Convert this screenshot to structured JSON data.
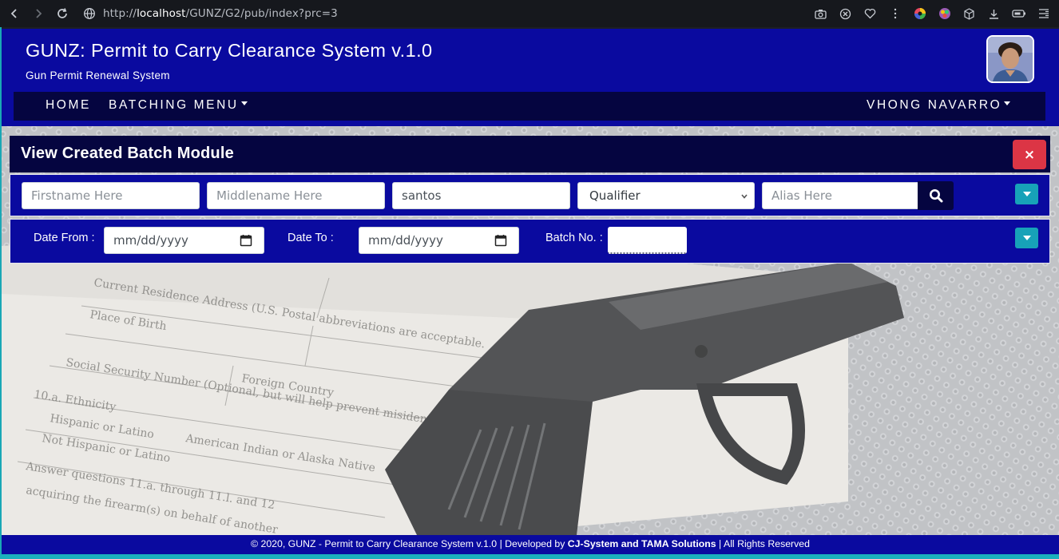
{
  "browser": {
    "url_prefix": "http://",
    "url_host": "localhost",
    "url_path": "/GUNZ/G2/pub/index?prc=3"
  },
  "header": {
    "title": "GUNZ: Permit to Carry Clearance System v.1.0",
    "subtitle": "Gun Permit Renewal System"
  },
  "nav": {
    "home": "HOME",
    "batching_menu": "BATCHING MENU",
    "user_menu": "VHONG NAVARRO"
  },
  "module": {
    "title": "View Created Batch Module",
    "close_label": "×"
  },
  "search": {
    "firstname_placeholder": "Firstname Here",
    "firstname_value": "",
    "middlename_placeholder": "Middlename Here",
    "middlename_value": "",
    "lastname_value": "santos",
    "qualifier_selected": "Qualifier",
    "alias_placeholder": "Alias Here",
    "alias_value": ""
  },
  "date_filter": {
    "date_from_label": "Date From :",
    "date_from_value": "mm/dd/yyyy",
    "date_to_label": "Date To :",
    "date_to_value": "mm/dd/yyyy",
    "batch_no_label": "Batch No. :",
    "batch_no_value": ""
  },
  "footer": {
    "prefix": "© 2020, GUNZ - Permit to Carry Clearance System v.1.0 | Developed by ",
    "developer": "CJ-System and TAMA Solutions",
    "suffix": " | All Rights Reserved"
  },
  "colors": {
    "header_blue": "#0a0a9f",
    "navy": "#050540",
    "danger": "#dc3545",
    "info": "#17a2b8"
  }
}
